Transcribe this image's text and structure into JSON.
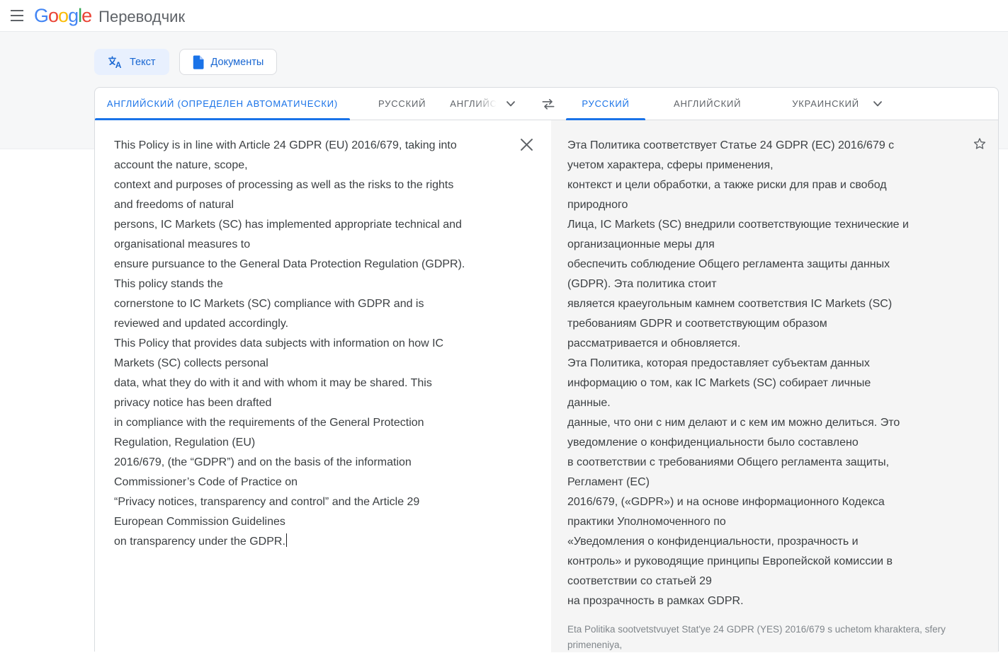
{
  "header": {
    "product": "Переводчик",
    "logo": [
      {
        "ch": "G",
        "color": "#4285F4"
      },
      {
        "ch": "o",
        "color": "#EA4335"
      },
      {
        "ch": "o",
        "color": "#FBBC05"
      },
      {
        "ch": "g",
        "color": "#4285F4"
      },
      {
        "ch": "l",
        "color": "#34A853"
      },
      {
        "ch": "e",
        "color": "#EA4335"
      }
    ]
  },
  "mode_tabs": {
    "text_label": "Текст",
    "documents_label": "Документы"
  },
  "source_language_tabs": {
    "detected": "АНГЛИЙСКИЙ (ОПРЕДЕЛЕН АВТОМАТИЧЕСКИ)",
    "option2": "РУССКИЙ",
    "option3": "АНГЛИЙСКИЙ"
  },
  "target_language_tabs": {
    "selected": "РУССКИЙ",
    "option2": "АНГЛИЙСКИЙ",
    "option3": "УКРАИНСКИЙ"
  },
  "source_panel": {
    "text_lines": [
      "This Policy is in line with Article 24 GDPR (EU) 2016/679, taking into",
      "account the nature, scope,",
      "context and purposes of processing as well as the risks to the rights",
      "and freedoms of natural",
      "persons, IC Markets (SC) has implemented appropriate technical and",
      "organisational measures to",
      "ensure pursuance to the General Data Protection Regulation (GDPR).",
      "This policy stands the",
      "cornerstone to IC Markets (SC) compliance with GDPR and is",
      "reviewed and updated accordingly.",
      "This Policy that provides data subjects with information on how IC",
      "Markets (SC) collects personal",
      "data, what they do with it and with whom it may be shared. This",
      "privacy notice has been drafted",
      "in compliance with the requirements of the General Protection",
      "Regulation, Regulation (EU)",
      "2016/679, (the “GDPR”) and on the basis of the information",
      "Commissioner’s Code of Practice on",
      "“Privacy notices, transparency and control” and the Article 29",
      "European Commission Guidelines",
      "on transparency under the GDPR."
    ]
  },
  "target_panel": {
    "text_lines": [
      "Эта Политика соответствует Статье 24 GDPR (ЕС) 2016/679 с",
      "учетом характера, сферы применения,",
      "контекст и цели обработки, а также риски для прав и свобод",
      "природного",
      "Лица, IC Markets (SC) внедрили соответствующие технические и",
      "организационные меры для",
      "обеспечить соблюдение Общего регламента защиты данных",
      "(GDPR). Эта политика стоит",
      "является краеугольным камнем соответствия IC Markets (SC)",
      "требованиям GDPR и соответствующим образом",
      "рассматривается и обновляется.",
      "Эта Политика, которая предоставляет субъектам данных",
      "информацию о том, как IC Markets (SC) собирает личные",
      "данные.",
      "данные, что они с ним делают и с кем им можно делиться. Это",
      "уведомление о конфиденциальности было составлено",
      "в соответствии с требованиями Общего регламента защиты,",
      "Регламент (ЕС)",
      "2016/679, («GDPR») и на основе информационного Кодекса",
      "практики Уполномоченного по",
      "«Уведомления о конфиденциальности, прозрачность и",
      "контроль» и руководящие принципы Европейской комиссии в",
      "соответствии со статьей 29",
      "на прозрачность в рамках GDPR."
    ],
    "transliteration": "Eta Politika sootvetstvuyet Stat'ye 24 GDPR (YES) 2016/679 s uchetom kharaktera, sfery primeneniya,"
  },
  "colors": {
    "accent_blue": "#1a73e8",
    "mode_button_blue": "#1967d2",
    "body_text": "#3c4043",
    "muted_gray": "#5f6368",
    "transliteration_gray": "#80868b",
    "target_panel_bg": "#f5f5f5",
    "border": "#dadce0"
  }
}
